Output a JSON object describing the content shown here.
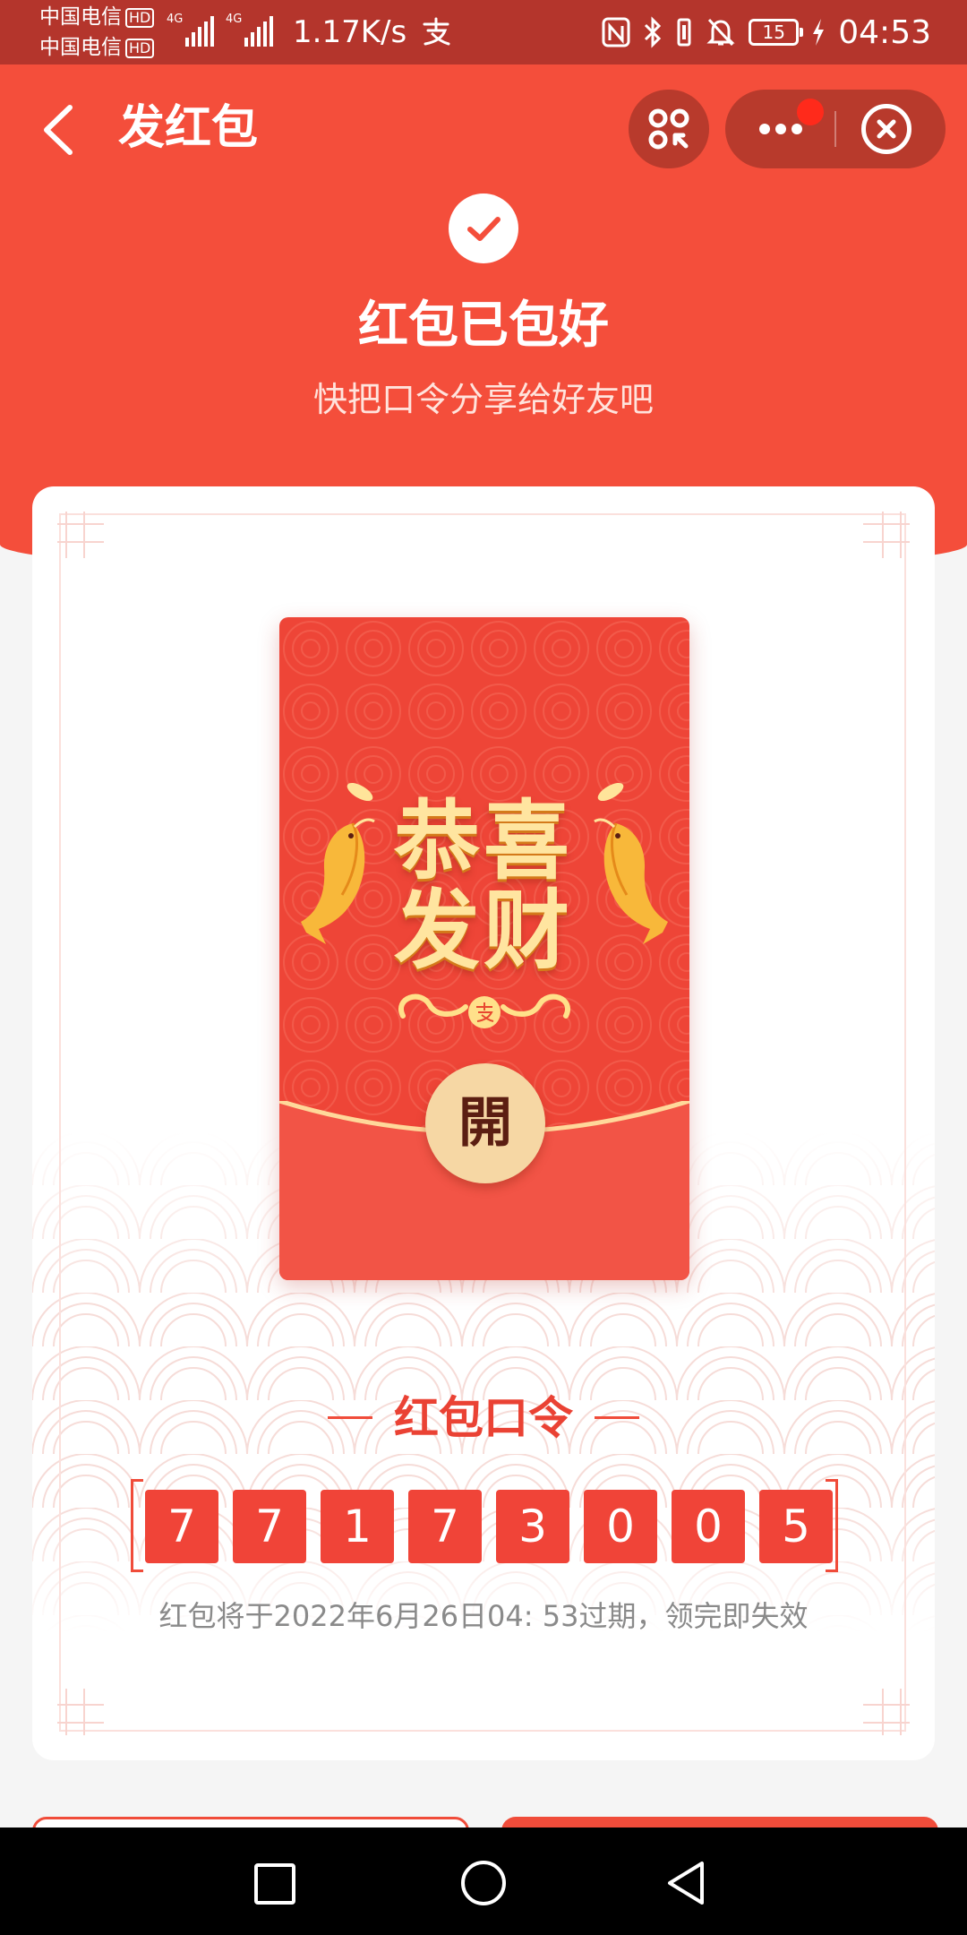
{
  "status_bar": {
    "carrier_1": "中国电信",
    "carrier_2": "中国电信",
    "hd_badge": "HD",
    "network_tag": "4G",
    "net_speed": "1.17K/s",
    "battery": "15",
    "time": "04:53",
    "icons": [
      "alipay-icon",
      "nfc-icon",
      "bluetooth-icon",
      "vibrate-icon",
      "mute-icon",
      "battery-icon",
      "charging-icon"
    ]
  },
  "nav": {
    "title": "发红包"
  },
  "success": {
    "title": "红包已包好",
    "subtitle": "快把口令分享给好友吧"
  },
  "envelope": {
    "greeting_line1": [
      "恭",
      "喜"
    ],
    "greeting_line2": [
      "发",
      "财"
    ],
    "open_label": "開"
  },
  "code": {
    "heading": "红包口令",
    "digits": [
      "7",
      "7",
      "1",
      "7",
      "3",
      "0",
      "0",
      "5"
    ],
    "expire_note": "红包将于2022年6月26日04: 53过期，领完即失效"
  },
  "colors": {
    "brand_red": "#f44e3b",
    "status_bar": "#b4352c",
    "digit_bg": "#f04438",
    "gold": "#ffe5a0"
  }
}
